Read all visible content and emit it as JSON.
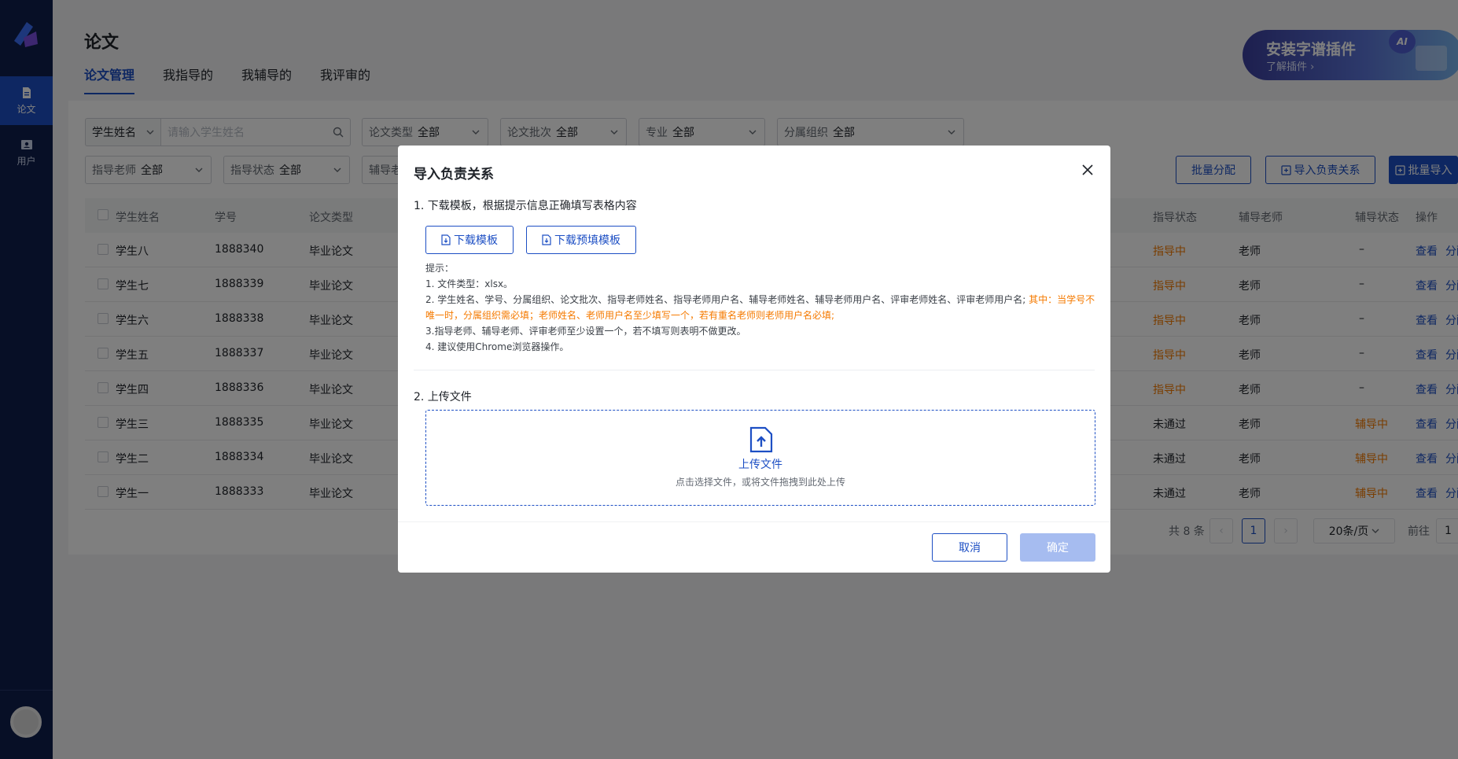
{
  "sidebar": {
    "items": [
      {
        "label": "论文",
        "icon": "document-icon"
      },
      {
        "label": "用户",
        "icon": "user-card-icon"
      }
    ]
  },
  "header": {
    "title": "论文",
    "tabs": [
      "论文管理",
      "我指导的",
      "我辅导的",
      "我评审的"
    ],
    "ai_banner": {
      "title": "安装字谱插件",
      "subtitle": "了解插件 ›",
      "badge": "AI"
    }
  },
  "filters": {
    "search_select": "学生姓名",
    "search_placeholder": "请输入学生姓名",
    "type": {
      "label": "论文类型",
      "value": "全部"
    },
    "batch": {
      "label": "论文批次",
      "value": "全部"
    },
    "major": {
      "label": "专业",
      "value": "全部"
    },
    "org": {
      "label": "分属组织",
      "value": "全部"
    },
    "advisor": {
      "label": "指导老师",
      "value": "全部"
    },
    "advise_status": {
      "label": "指导状态",
      "value": "全部"
    },
    "tutor": {
      "label": "辅导老"
    }
  },
  "actions": {
    "batch_assign": "批量分配",
    "import_relation": "导入负责关系",
    "batch_import": "批量导入"
  },
  "table": {
    "headers": [
      "学生姓名",
      "学号",
      "论文类型",
      "指导状态",
      "辅导老师",
      "辅导状态",
      "操作"
    ],
    "rows": [
      {
        "name": "学生八",
        "id": "1888340",
        "type": "毕业论文",
        "status": "指导中",
        "tutor": "老师",
        "tutor_status": "–",
        "view": "查看",
        "assign": "分配"
      },
      {
        "name": "学生七",
        "id": "1888339",
        "type": "毕业论文",
        "status": "指导中",
        "tutor": "老师",
        "tutor_status": "–",
        "view": "查看",
        "assign": "分配"
      },
      {
        "name": "学生六",
        "id": "1888338",
        "type": "毕业论文",
        "status": "指导中",
        "tutor": "老师",
        "tutor_status": "–",
        "view": "查看",
        "assign": "分配"
      },
      {
        "name": "学生五",
        "id": "1888337",
        "type": "毕业论文",
        "status": "指导中",
        "tutor": "老师",
        "tutor_status": "–",
        "view": "查看",
        "assign": "分配"
      },
      {
        "name": "学生四",
        "id": "1888336",
        "type": "毕业论文",
        "status": "指导中",
        "tutor": "老师",
        "tutor_status": "–",
        "view": "查看",
        "assign": "分配"
      },
      {
        "name": "学生三",
        "id": "1888335",
        "type": "毕业论文",
        "status": "未通过",
        "tutor": "老师",
        "tutor_status": "辅导中",
        "view": "查看",
        "assign": "分配"
      },
      {
        "name": "学生二",
        "id": "1888334",
        "type": "毕业论文",
        "status": "未通过",
        "tutor": "老师",
        "tutor_status": "辅导中",
        "view": "查看",
        "assign": "分配"
      },
      {
        "name": "学生一",
        "id": "1888333",
        "type": "毕业论文",
        "status": "未通过",
        "tutor": "老师",
        "tutor_status": "辅导中",
        "view": "查看",
        "assign": "分配"
      }
    ]
  },
  "pagination": {
    "total": "共 8 条",
    "prev": "‹",
    "current": "1",
    "next": "›",
    "page_size": "20条/页",
    "goto_label": "前往",
    "goto_value": "1"
  },
  "modal": {
    "title": "导入负责关系",
    "step1": "1. 下载模板，根据提示信息正确填写表格内容",
    "download_template": "下载模板",
    "download_prefilled": "下载预填模板",
    "tips_title": "提示：",
    "tip1": "1. 文件类型：xlsx。",
    "tip2_normal": "2. 学生姓名、学号、分属组织、论文批次、指导老师姓名、指导老师用户名、辅导老师姓名、辅导老师用户名、评审老师姓名、评审老师用户名; ",
    "tip2_orange_a": "其中：当学号不",
    "tip2_orange_b": "唯一时，分属组织需必填；老师姓名、老师用户名至少填写一个，若有重名老师则老师用户名必填;",
    "tip3": "3.指导老师、辅导老师、评审老师至少设置一个，若不填写则表明不做更改。",
    "tip4": "4. 建议使用Chrome浏览器操作。",
    "step2": "2. 上传文件",
    "upload_title": "上传文件",
    "upload_hint": "点击选择文件，或将文件拖拽到此处上传",
    "cancel": "取消",
    "confirm": "确定"
  },
  "colors": {
    "primary": "#1d4fc4",
    "sidebar": "#0f1f4d",
    "warning": "#f57a00",
    "confirm_disabled": "#a6bcf0"
  }
}
